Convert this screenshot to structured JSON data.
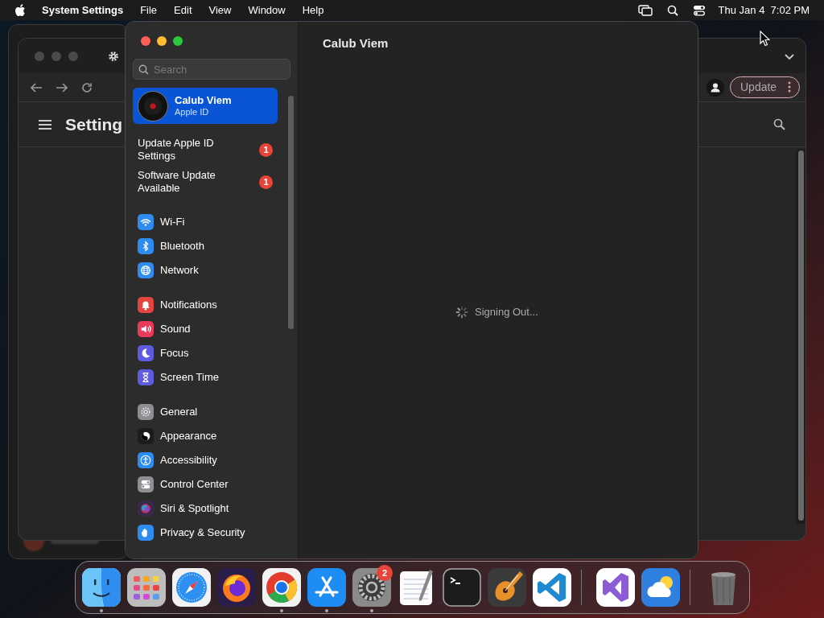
{
  "menu_bar": {
    "app": "System Settings",
    "menus": [
      "File",
      "Edit",
      "View",
      "Window",
      "Help"
    ],
    "clock": "Thu Jan 4  7:02 PM"
  },
  "browser_window": {
    "page_title": "Setting",
    "update_button": "Update"
  },
  "settings": {
    "title": "Calub Viem",
    "search": {
      "placeholder": "Search"
    },
    "account": {
      "name": "Calub Viem",
      "subtitle": "Apple ID",
      "selected": true
    },
    "alerts": [
      {
        "label": "Update Apple ID Settings",
        "badge": "1"
      },
      {
        "label": "Software Update Available",
        "badge": "1"
      }
    ],
    "groups": [
      [
        {
          "label": "Wi-Fi",
          "kind": "wifi",
          "color": "#2e8cf0"
        },
        {
          "label": "Bluetooth",
          "kind": "bluetooth",
          "color": "#2e8cf0"
        },
        {
          "label": "Network",
          "kind": "globe",
          "color": "#2e8cf0"
        }
      ],
      [
        {
          "label": "Notifications",
          "kind": "bell",
          "color": "#e5453f"
        },
        {
          "label": "Sound",
          "kind": "speaker",
          "color": "#e93a5a"
        },
        {
          "label": "Focus",
          "kind": "moon",
          "color": "#5d5ce0"
        },
        {
          "label": "Screen Time",
          "kind": "hourglass",
          "color": "#5d5ce0"
        }
      ],
      [
        {
          "label": "General",
          "kind": "gear",
          "color": "#8e8e93"
        },
        {
          "label": "Appearance",
          "kind": "contrast",
          "color": "#1c1c1c"
        },
        {
          "label": "Accessibility",
          "kind": "person",
          "color": "#2e8cf0"
        },
        {
          "label": "Control Center",
          "kind": "toggles",
          "color": "#8e8e93"
        },
        {
          "label": "Siri & Spotlight",
          "kind": "orb",
          "color": "#3a2a4a"
        },
        {
          "label": "Privacy & Security",
          "kind": "hand",
          "color": "#2e8cf0"
        }
      ]
    ],
    "status": "Signing Out..."
  },
  "dock": {
    "apps": [
      {
        "kind": "finder",
        "running": true
      },
      {
        "kind": "launchpad",
        "running": false
      },
      {
        "kind": "safari",
        "running": false
      },
      {
        "kind": "firefox",
        "running": false
      },
      {
        "kind": "chrome",
        "running": true
      },
      {
        "kind": "appstore",
        "running": true
      },
      {
        "kind": "settings",
        "running": true,
        "badge": "2"
      },
      {
        "kind": "textedit",
        "running": false
      },
      {
        "kind": "terminal",
        "running": false
      },
      {
        "kind": "guitar",
        "running": false
      },
      {
        "kind": "vscode",
        "running": false,
        "divider_after": true
      },
      {
        "kind": "vs",
        "running": false
      },
      {
        "kind": "weather",
        "running": false,
        "divider_after": true
      },
      {
        "kind": "trash",
        "running": false
      }
    ]
  }
}
